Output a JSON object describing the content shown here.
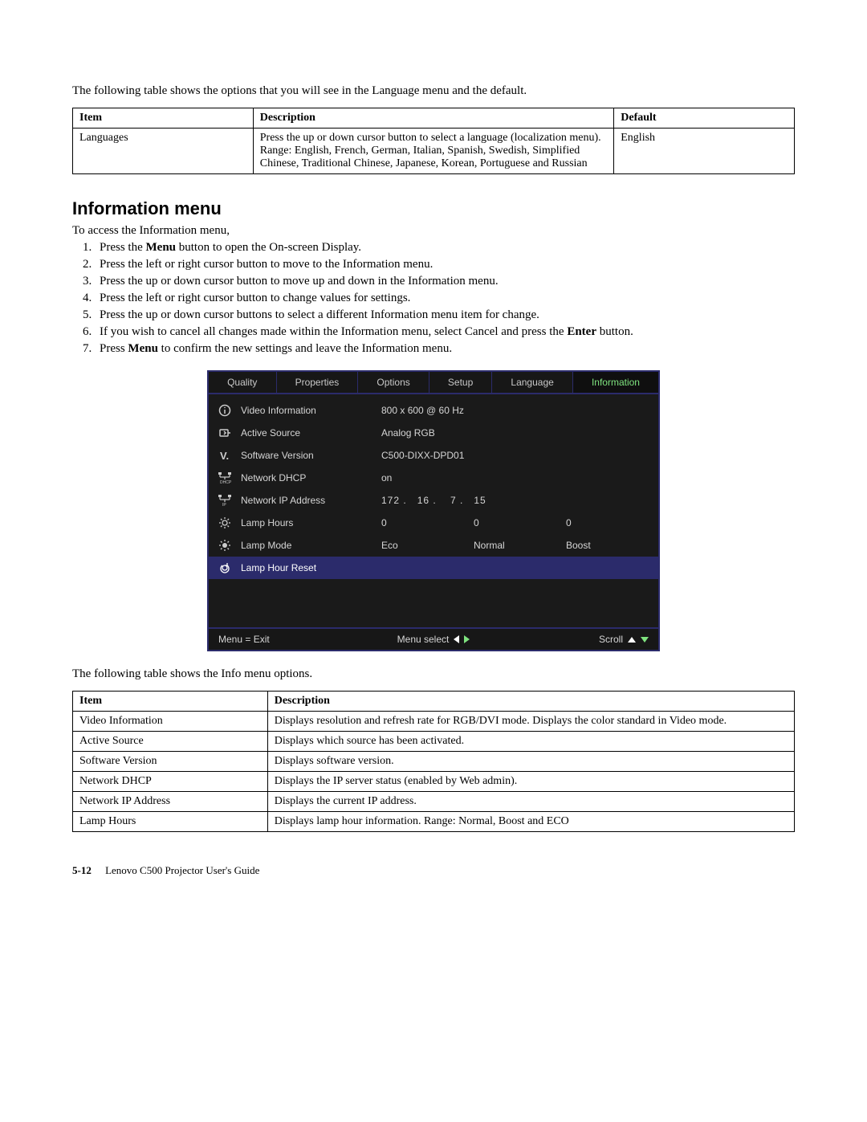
{
  "intro_language_text": "The following table shows the options that you will see in the Language menu and the default.",
  "table1": {
    "headers": {
      "item": "Item",
      "description": "Description",
      "default": "Default"
    },
    "row": {
      "item": "Languages",
      "description": "Press the up or down cursor button to select a language (localization menu). Range: English, French, German, Italian, Spanish, Swedish, Simplified Chinese, Traditional Chinese, Japanese, Korean, Portuguese and Russian",
      "default": "English"
    }
  },
  "section_heading": "Information menu",
  "access_text": "To access the Information menu,",
  "steps": {
    "s1_a": "Press the ",
    "s1_b": "Menu",
    "s1_c": " button to open the On-screen Display.",
    "s2": "Press the left or right cursor button to move to the Information menu.",
    "s3": "Press the up or down cursor button to move up and down in the Information menu.",
    "s4": "Press the left or right cursor button to change values for settings.",
    "s5": "Press the up or down cursor buttons to select a different Information menu item for change.",
    "s6_a": "If you wish to cancel all changes made within the Information menu, select Cancel and press the ",
    "s6_b": "Enter",
    "s6_c": " button.",
    "s7_a": "Press ",
    "s7_b": "Menu",
    "s7_c": " to confirm the new settings and leave the Information menu."
  },
  "osd": {
    "tabs": [
      "Quality",
      "Properties",
      "Options",
      "Setup",
      "Language",
      "Information"
    ],
    "rows": {
      "video_info": {
        "label": "Video Information",
        "value": "800  x  600  @  60  Hz"
      },
      "active_source": {
        "label": "Active Source",
        "value": "Analog RGB"
      },
      "software_version": {
        "label": "Software Version",
        "value": "C500-DIXX-DPD01"
      },
      "network_dhcp": {
        "label": "Network DHCP",
        "value": "on"
      },
      "network_ip": {
        "label": "Network IP Address",
        "value": "172 .   16 .    7 .   15"
      },
      "lamp_hours": {
        "label": "Lamp Hours",
        "v1": "0",
        "v2": "0",
        "v3": "0"
      },
      "lamp_mode": {
        "label": "Lamp Mode",
        "v1": "Eco",
        "v2": "Normal",
        "v3": "Boost"
      },
      "lamp_hour_reset": {
        "label": "Lamp Hour Reset"
      }
    },
    "footer": {
      "menu_exit": "Menu = Exit",
      "menu_select": "Menu select",
      "scroll": "Scroll"
    }
  },
  "intro_info_table_text": "The following table shows the Info menu options.",
  "table2": {
    "headers": {
      "item": "Item",
      "description": "Description"
    },
    "rows": [
      {
        "item": "Video Information",
        "description": "Displays resolution and refresh rate for RGB/DVI mode. Displays the color standard in Video mode."
      },
      {
        "item": "Active Source",
        "description": "Displays which source has been activated."
      },
      {
        "item": "Software Version",
        "description": "Displays software version."
      },
      {
        "item": "Network DHCP",
        "description": "Displays the IP server status (enabled by Web admin)."
      },
      {
        "item": "Network IP Address",
        "description": "Displays the current IP address."
      },
      {
        "item": "Lamp Hours",
        "description": "Displays lamp hour information. Range: Normal, Boost and ECO"
      }
    ]
  },
  "footer": {
    "page": "5-12",
    "title": "Lenovo C500 Projector User's Guide"
  }
}
